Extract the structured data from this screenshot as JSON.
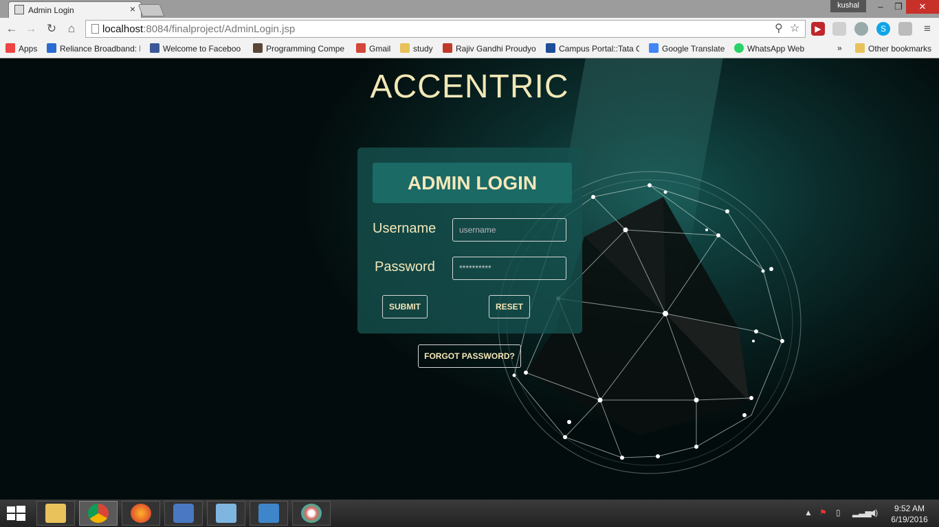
{
  "browser": {
    "tab_title": "Admin Login",
    "tab_close": "×",
    "profile": "kushal",
    "url_host": "localhost",
    "url_rest": ":8084/finalproject/AdminLogin.jsp",
    "window_buttons": {
      "minimize": "–",
      "maximize": "❐",
      "close": "✕"
    }
  },
  "bookmarks": [
    {
      "label": "Apps",
      "icon": "apps-grid-icon",
      "color": "#e44"
    },
    {
      "label": "Reliance Broadband: L",
      "icon": "reliance-icon",
      "color": "#2a6ad1"
    },
    {
      "label": "Welcome to Faceboo",
      "icon": "facebook-icon",
      "color": "#3b5998"
    },
    {
      "label": "Programming Compe",
      "icon": "codechef-icon",
      "color": "#5b4636"
    },
    {
      "label": "Gmail",
      "icon": "gmail-icon",
      "color": "#d44638"
    },
    {
      "label": "study",
      "icon": "folder-icon",
      "color": "#e8c15a"
    },
    {
      "label": "Rajiv Gandhi Proudyo",
      "icon": "rgpv-icon",
      "color": "#c0392b"
    },
    {
      "label": "Campus Portal::Tata C",
      "icon": "tata-icon",
      "color": "#1d4e9a"
    },
    {
      "label": "Google Translate",
      "icon": "google-translate-icon",
      "color": "#4285f4"
    },
    {
      "label": "WhatsApp Web",
      "icon": "whatsapp-icon",
      "color": "#25d366"
    }
  ],
  "bookmarks_overflow": "»",
  "other_bookmarks": "Other bookmarks",
  "page": {
    "site_title": "ACCENTRIC",
    "login_heading": "ADMIN LOGIN",
    "username_label": "Username",
    "username_placeholder": "username",
    "password_label": "Password",
    "password_value": "**********",
    "submit_label": "SUBMIT",
    "reset_label": "RESET",
    "forgot_label": "FORGOT PASSWORD?"
  },
  "taskbar": {
    "time": "9:52 AM",
    "date": "6/19/2016",
    "apps": [
      "windows-start-icon",
      "file-explorer-icon",
      "chrome-icon",
      "firefox-icon",
      "virtualbox-icon",
      "notepad-icon",
      "remote-desktop-icon",
      "paint-icon"
    ]
  },
  "colors": {
    "accent_text": "#f4e7b9",
    "panel": "#165250",
    "background": "#061a1a"
  }
}
